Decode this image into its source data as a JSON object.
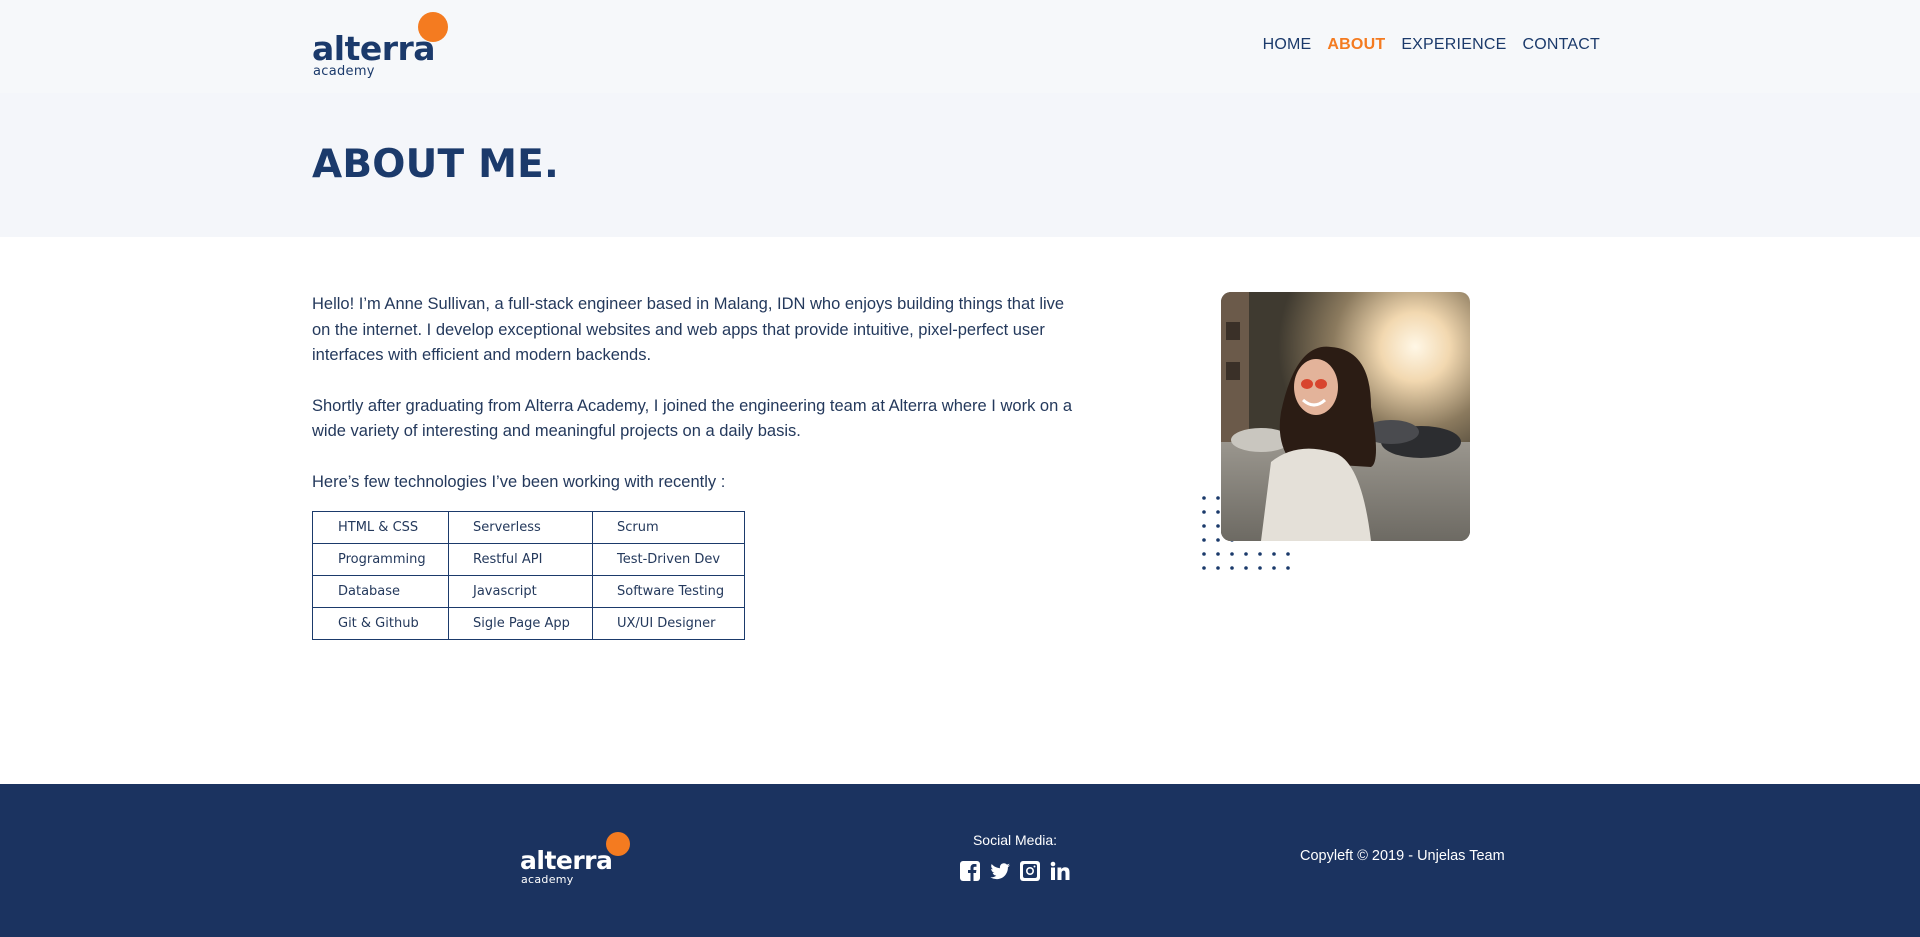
{
  "colors": {
    "brand_navy": "#1b3a6b",
    "accent_orange": "#f47b20",
    "footer_bg": "#1b3360"
  },
  "header": {
    "logo": {
      "word": "alterra",
      "sub": "academy"
    },
    "nav": [
      {
        "label": "HOME",
        "active": false
      },
      {
        "label": "ABOUT",
        "active": true
      },
      {
        "label": "EXPERIENCE",
        "active": false
      },
      {
        "label": "CONTACT",
        "active": false
      }
    ]
  },
  "page_title": "ABOUT ME.",
  "about": {
    "paragraphs": [
      "Hello! I’m Anne Sullivan, a full-stack engineer based in Malang, IDN who enjoys building things that live on the internet. I develop exceptional websites and web apps that provide intuitive, pixel-perfect user interfaces with efficient and modern backends.",
      "Shortly after graduating from Alterra Academy, I joined the engineering team at Alterra where I work on a wide variety of interesting and meaningful projects on a daily basis.",
      "Here’s few technologies I’ve been working with recently :"
    ],
    "technologies": [
      [
        "HTML & CSS",
        "Serverless",
        "Scrum"
      ],
      [
        "Programming",
        "Restful API",
        "Test-Driven Dev"
      ],
      [
        "Database",
        "Javascript",
        "Software Testing"
      ],
      [
        "Git & Github",
        "Sigle Page App",
        "UX/UI Designer"
      ]
    ]
  },
  "footer": {
    "logo": {
      "word": "alterra",
      "sub": "academy"
    },
    "social_label": "Social Media:",
    "social_icons": [
      "facebook-icon",
      "twitter-icon",
      "instagram-icon",
      "linkedin-icon"
    ],
    "copyright": "Copyleft © 2019 - Unjelas Team"
  }
}
